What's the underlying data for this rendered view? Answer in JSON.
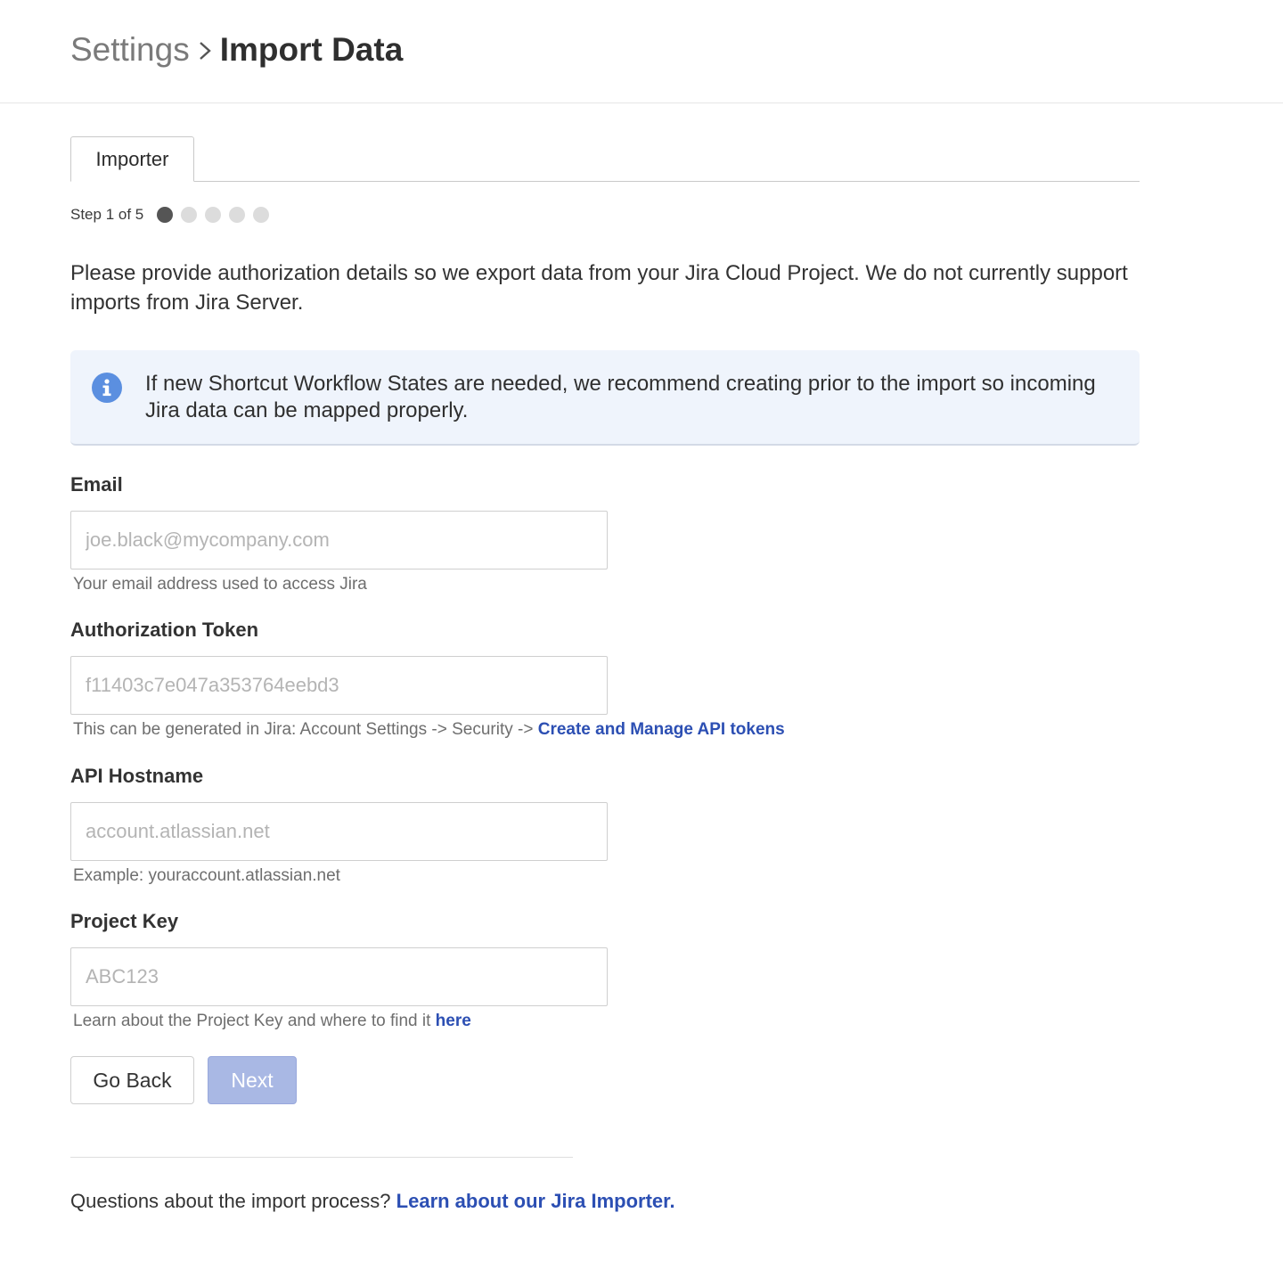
{
  "breadcrumb": {
    "parent": "Settings",
    "current": "Import Data"
  },
  "tabs": [
    {
      "label": "Importer",
      "active": true
    }
  ],
  "stepper": {
    "label": "Step 1 of 5",
    "current": 1,
    "total": 5
  },
  "intro": "Please provide authorization details so we export data from your Jira Cloud Project. We do not currently support imports from Jira Server.",
  "info": {
    "icon": "info-icon",
    "text": "If new Shortcut Workflow States are needed, we recommend creating prior to the import so incoming Jira data can be mapped properly."
  },
  "form": {
    "email": {
      "label": "Email",
      "value": "",
      "placeholder": "joe.black@mycompany.com",
      "help": "Your email address used to access Jira"
    },
    "token": {
      "label": "Authorization Token",
      "value": "",
      "placeholder": "f11403c7e047a353764eebd3",
      "help": "This can be generated in Jira: Account Settings -> Security ->",
      "help_link": "Create and Manage API tokens"
    },
    "hostname": {
      "label": "API Hostname",
      "value": "",
      "placeholder": "account.atlassian.net",
      "help": "Example: youraccount.atlassian.net"
    },
    "project_key": {
      "label": "Project Key",
      "value": "",
      "placeholder": "ABC123",
      "help": "Learn about the Project Key and where to find it",
      "help_link": "here"
    }
  },
  "buttons": {
    "back": "Go Back",
    "next": "Next"
  },
  "footer": {
    "text": "Questions about the import process?",
    "link": "Learn about our Jira Importer."
  },
  "colors": {
    "link": "#2c4fb3",
    "info_bg": "#eff4fc",
    "info_icon": "#5b8fe0",
    "next_disabled": "#a9b8e4"
  }
}
